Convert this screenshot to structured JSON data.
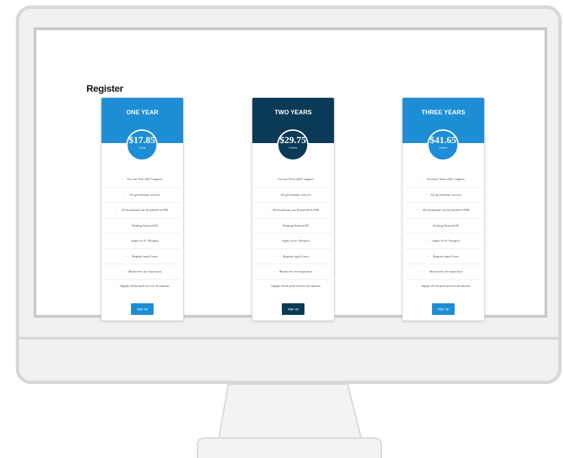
{
  "page": {
    "title": "Register"
  },
  "colors": {
    "light_blue": "#1d8ed6",
    "dark_blue": "#0b3a57"
  },
  "plans": [
    {
      "name": "ONE YEAR",
      "price": "$17.85",
      "period": "/1 year",
      "accent": "#1d8ed6",
      "features": [
        "For one Year 24h/7 support.",
        "All government services.",
        "All documents can be printed in PDF.",
        "Printing National ID.",
        "Apply for E- Passport.",
        "Register legal Cases.",
        "Return fees for inspection.",
        "Supply all the paid services documents."
      ],
      "button": "Sign Up"
    },
    {
      "name": "TWO YEARS",
      "price": "$29.75",
      "period": "/2 years",
      "accent": "#0b3a57",
      "features": [
        "For two Years 24h/7 support.",
        "All government services.",
        "All documents can be printed in PDF.",
        "Printing National ID.",
        "Apply for E- Passport.",
        "Register legal Cases.",
        "Return fees for inspection.",
        "Supply all the paid services documents."
      ],
      "button": "Sign Up"
    },
    {
      "name": "THREE YEARS",
      "price": "$41.65",
      "period": "/3 years",
      "accent": "#1d8ed6",
      "features": [
        "For three Years 24h/7 support.",
        "All government services.",
        "All documents can be printed in PDF.",
        "Printing National ID.",
        "Apply for E- Passport.",
        "Register legal Cases.",
        "Return fees for inspection.",
        "Supply all the paid services documents."
      ],
      "button": "Sign Up"
    }
  ]
}
